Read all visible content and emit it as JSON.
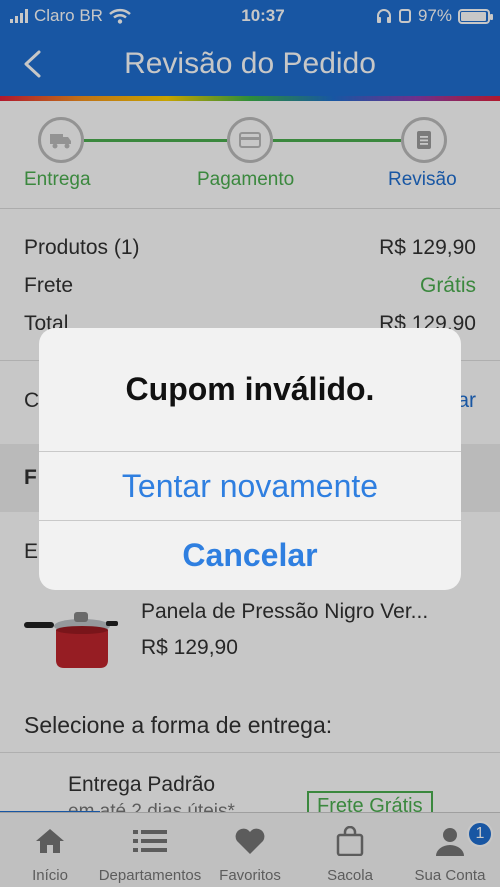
{
  "status_bar": {
    "carrier": "Claro BR",
    "time": "10:37",
    "battery": "97%"
  },
  "header": {
    "title": "Revisão do Pedido"
  },
  "stepper": {
    "steps": [
      {
        "label": "Entrega",
        "icon": "truck-icon",
        "color": "#4caf50"
      },
      {
        "label": "Pagamento",
        "icon": "credit-card-icon",
        "color": "#4caf50"
      },
      {
        "label": "Revisão",
        "icon": "receipt-icon",
        "color": "#1f6fd1"
      }
    ]
  },
  "summary": {
    "products_label": "Produtos (1)",
    "products_value": "R$ 129,90",
    "shipping_label": "Frete",
    "shipping_value": "Grátis",
    "total_label": "Total",
    "total_value": "R$ 129,90"
  },
  "coupon": {
    "left_text": "C",
    "right_text": "ar"
  },
  "section": {
    "head_text": "F"
  },
  "em_row": {
    "text": "E"
  },
  "product": {
    "name": "Panela de Pressão Nigro Ver...",
    "price": "R$ 129,90",
    "image_icon": "pressure-cooker-icon"
  },
  "delivery": {
    "title": "Selecione a forma de entrega:",
    "option_name": "Entrega Padrão",
    "option_sub": "em até 2 dias úteis*",
    "option_badge": "Frete Grátis"
  },
  "tabbar": {
    "tabs": [
      {
        "label": "Início",
        "icon": "home-icon"
      },
      {
        "label": "Departamentos",
        "icon": "list-icon"
      },
      {
        "label": "Favoritos",
        "icon": "heart-icon"
      },
      {
        "label": "Sacola",
        "icon": "bag-icon"
      },
      {
        "label": "Sua Conta",
        "icon": "user-icon"
      }
    ],
    "account_badge": "1"
  },
  "dialog": {
    "title": "Cupom inválido.",
    "retry_label": "Tentar novamente",
    "cancel_label": "Cancelar"
  },
  "colors": {
    "brand_blue": "#1f6fd1",
    "success_green": "#4caf50",
    "dialog_link": "#2f7fe0"
  }
}
